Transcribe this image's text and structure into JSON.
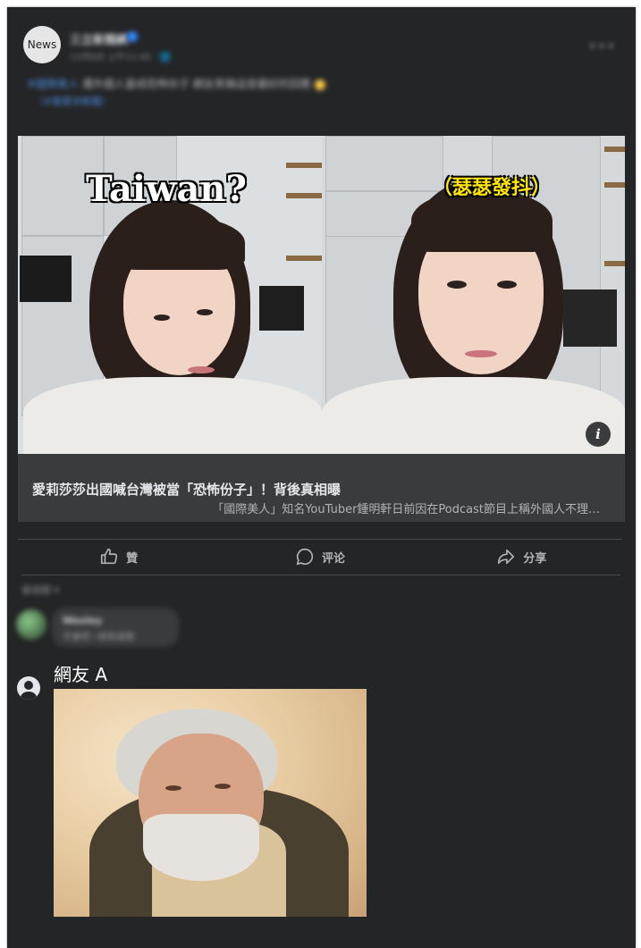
{
  "post": {
    "avatar_label": "News",
    "page_name": "三立新聞網",
    "meta": "12月6日 上午11:45 · 🌐",
    "text_tag": "#國際美人",
    "text_body": " 遭外國人當成恐怖份子  網友笑稱這是最好的回應",
    "link_text": "（#看更多新聞）",
    "more_icon": "ellipsis-icon"
  },
  "media": {
    "left_caption": "Taiwan?",
    "right_caption": "（瑟瑟發抖）",
    "info_label": "i"
  },
  "link_card": {
    "title": "愛莉莎莎出國喊台灣被當「恐怖份子」！背後真相曝",
    "description": "「國際美人」知名YouTuber鍾明軒日前因在Podcast節目上稱外國人不理…"
  },
  "actions": [
    {
      "label": "贊",
      "icon": "thumbs-up-icon"
    },
    {
      "label": "评论",
      "icon": "comment-icon"
    },
    {
      "label": "分享",
      "icon": "share-icon"
    }
  ],
  "comments": {
    "sort_label": "最相關 ▾",
    "first": {
      "name": "Wesley",
      "text": "不會吧～很有道理"
    },
    "second": {
      "name": "網友 A"
    }
  },
  "colors": {
    "background": "#242526",
    "card": "#3a3b3c",
    "accent": "#2d88ff"
  }
}
